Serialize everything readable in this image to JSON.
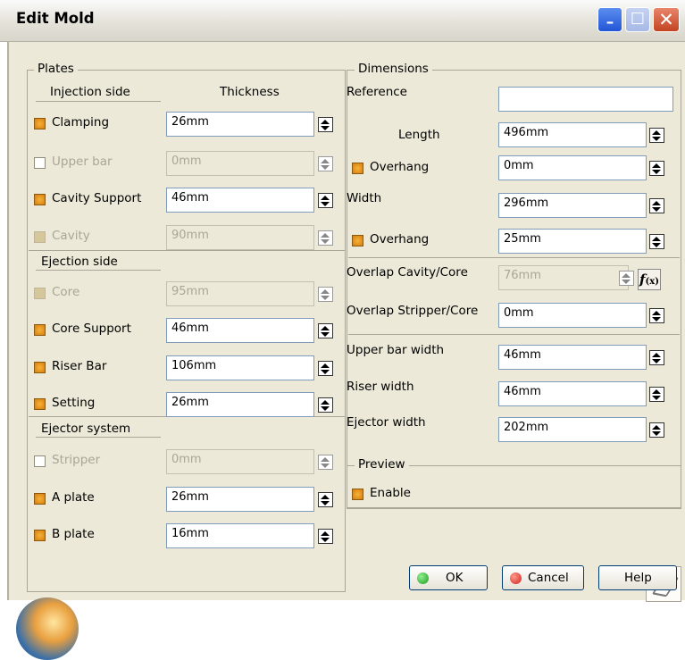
{
  "window": {
    "title": "Edit Mold"
  },
  "plates": {
    "legend": "Plates",
    "injection_header": "Injection side",
    "thickness_header": "Thickness",
    "ejection_header": "Ejection side",
    "ejector_header": "Ejector system",
    "rows": [
      {
        "label": "Clamping",
        "value": "26mm",
        "checked": true,
        "disabled": false
      },
      {
        "label": "Upper bar",
        "value": "0mm",
        "checked": false,
        "disabled": true
      },
      {
        "label": "Cavity Support",
        "value": "46mm",
        "checked": true,
        "disabled": false
      },
      {
        "label": "Cavity",
        "value": "90mm",
        "checked": true,
        "disabled": true
      },
      {
        "label": "Core",
        "value": "95mm",
        "checked": true,
        "disabled": true
      },
      {
        "label": "Core Support",
        "value": "46mm",
        "checked": true,
        "disabled": false
      },
      {
        "label": "Riser Bar",
        "value": "106mm",
        "checked": true,
        "disabled": false
      },
      {
        "label": "Setting",
        "value": "26mm",
        "checked": true,
        "disabled": false
      },
      {
        "label": "Stripper",
        "value": "0mm",
        "checked": false,
        "disabled": true
      },
      {
        "label": "A plate",
        "value": "26mm",
        "checked": true,
        "disabled": false
      },
      {
        "label": "B plate",
        "value": "16mm",
        "checked": true,
        "disabled": false
      }
    ]
  },
  "dimensions": {
    "legend": "Dimensions",
    "reference_label": "Reference",
    "reference_value": "",
    "length_label": "Length",
    "length_value": "496mm",
    "overhang1_label": "Overhang",
    "overhang1_value": "0mm",
    "width_label": "Width",
    "width_value": "296mm",
    "overhang2_label": "Overhang",
    "overhang2_value": "25mm",
    "overlap_cavity_label": "Overlap Cavity/Core",
    "overlap_cavity_value": "76mm",
    "overlap_stripper_label": "Overlap Stripper/Core",
    "overlap_stripper_value": "0mm",
    "upper_bar_width_label": "Upper bar width",
    "upper_bar_width_value": "46mm",
    "riser_width_label": "Riser width",
    "riser_width_value": "46mm",
    "ejector_width_label": "Ejector width",
    "ejector_width_value": "202mm"
  },
  "preview": {
    "legend": "Preview",
    "enable_label": "Enable"
  },
  "buttons": {
    "ok": "OK",
    "cancel": "Cancel",
    "help": "Help"
  },
  "colors": {
    "accent_check": "#e8a020",
    "ok_dot": "#1f9a1f",
    "cancel_dot": "#d02020"
  }
}
